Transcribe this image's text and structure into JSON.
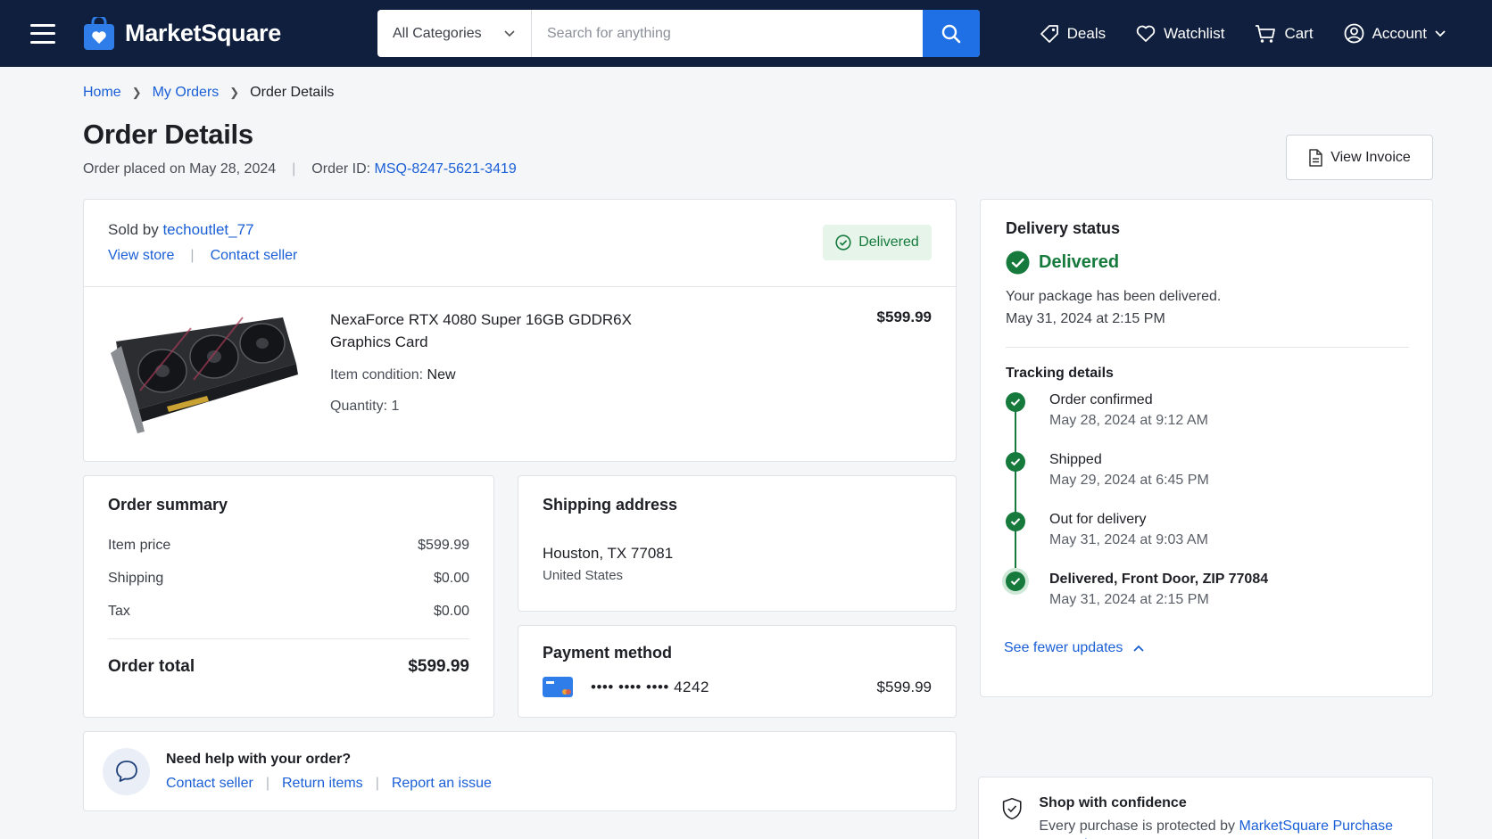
{
  "header": {
    "brand": "MarketSquare",
    "category": "All Categories",
    "search_placeholder": "Search for anything",
    "nav": {
      "deals": "Deals",
      "watchlist": "Watchlist",
      "cart": "Cart",
      "account": "Account"
    }
  },
  "breadcrumb": [
    "Home",
    "My Orders",
    "Order Details"
  ],
  "page": {
    "title": "Order Details",
    "placed": "Order placed on May 28, 2024",
    "order_id_label": "Order ID:",
    "order_id": "MSQ-8247-5621-3419",
    "invoice_button": "View Invoice"
  },
  "item": {
    "sold_by_label": "Sold by",
    "seller": "techoutlet_77",
    "view_store": "View store",
    "contact_seller": "Contact seller",
    "status_badge": "Delivered",
    "name": "NexaForce RTX 4080 Super 16GB GDDR6X Graphics Card",
    "condition_label": "Item condition:",
    "condition": "New",
    "quantity": "Quantity: 1",
    "price": "$599.99"
  },
  "summary": {
    "title": "Order summary",
    "rows": [
      {
        "label": "Item price",
        "value": "$599.99"
      },
      {
        "label": "Shipping",
        "value": "$0.00"
      },
      {
        "label": "Tax",
        "value": "$0.00"
      }
    ],
    "total_label": "Order total",
    "total": "$599.99"
  },
  "shipping": {
    "title": "Shipping address",
    "line1": "Houston, TX 77081",
    "line2": "United States"
  },
  "payment": {
    "title": "Payment method",
    "card": "•••• •••• •••• 4242",
    "amount": "$599.99"
  },
  "help": {
    "title": "Need help with your order?",
    "links": [
      "Contact seller",
      "Return items",
      "Report an issue"
    ]
  },
  "delivery": {
    "title": "Delivery status",
    "status": "Delivered",
    "message": "Your package has been delivered.",
    "time": "May 31, 2024 at 2:15 PM",
    "tracking_title": "Tracking details",
    "events": [
      {
        "name": "Order confirmed",
        "time": "May 28, 2024 at 9:12 AM"
      },
      {
        "name": "Shipped",
        "time": "May 29, 2024 at 6:45 PM"
      },
      {
        "name": "Out for delivery",
        "time": "May 31, 2024 at 9:03 AM"
      },
      {
        "name": "Delivered, Front Door, ZIP 77084",
        "time": "May 31, 2024 at 2:15 PM"
      }
    ],
    "toggle": "See fewer updates"
  },
  "confidence": {
    "title": "Shop with confidence",
    "desc_prefix": "Every purchase is protected by",
    "link": "MarketSquare Purchase Protection",
    "desc_suffix": "."
  },
  "colors": {
    "header_bg": "#0f1f3d",
    "accent": "#1f6fe5",
    "link": "#1a5fd6",
    "success": "#157a3c"
  }
}
